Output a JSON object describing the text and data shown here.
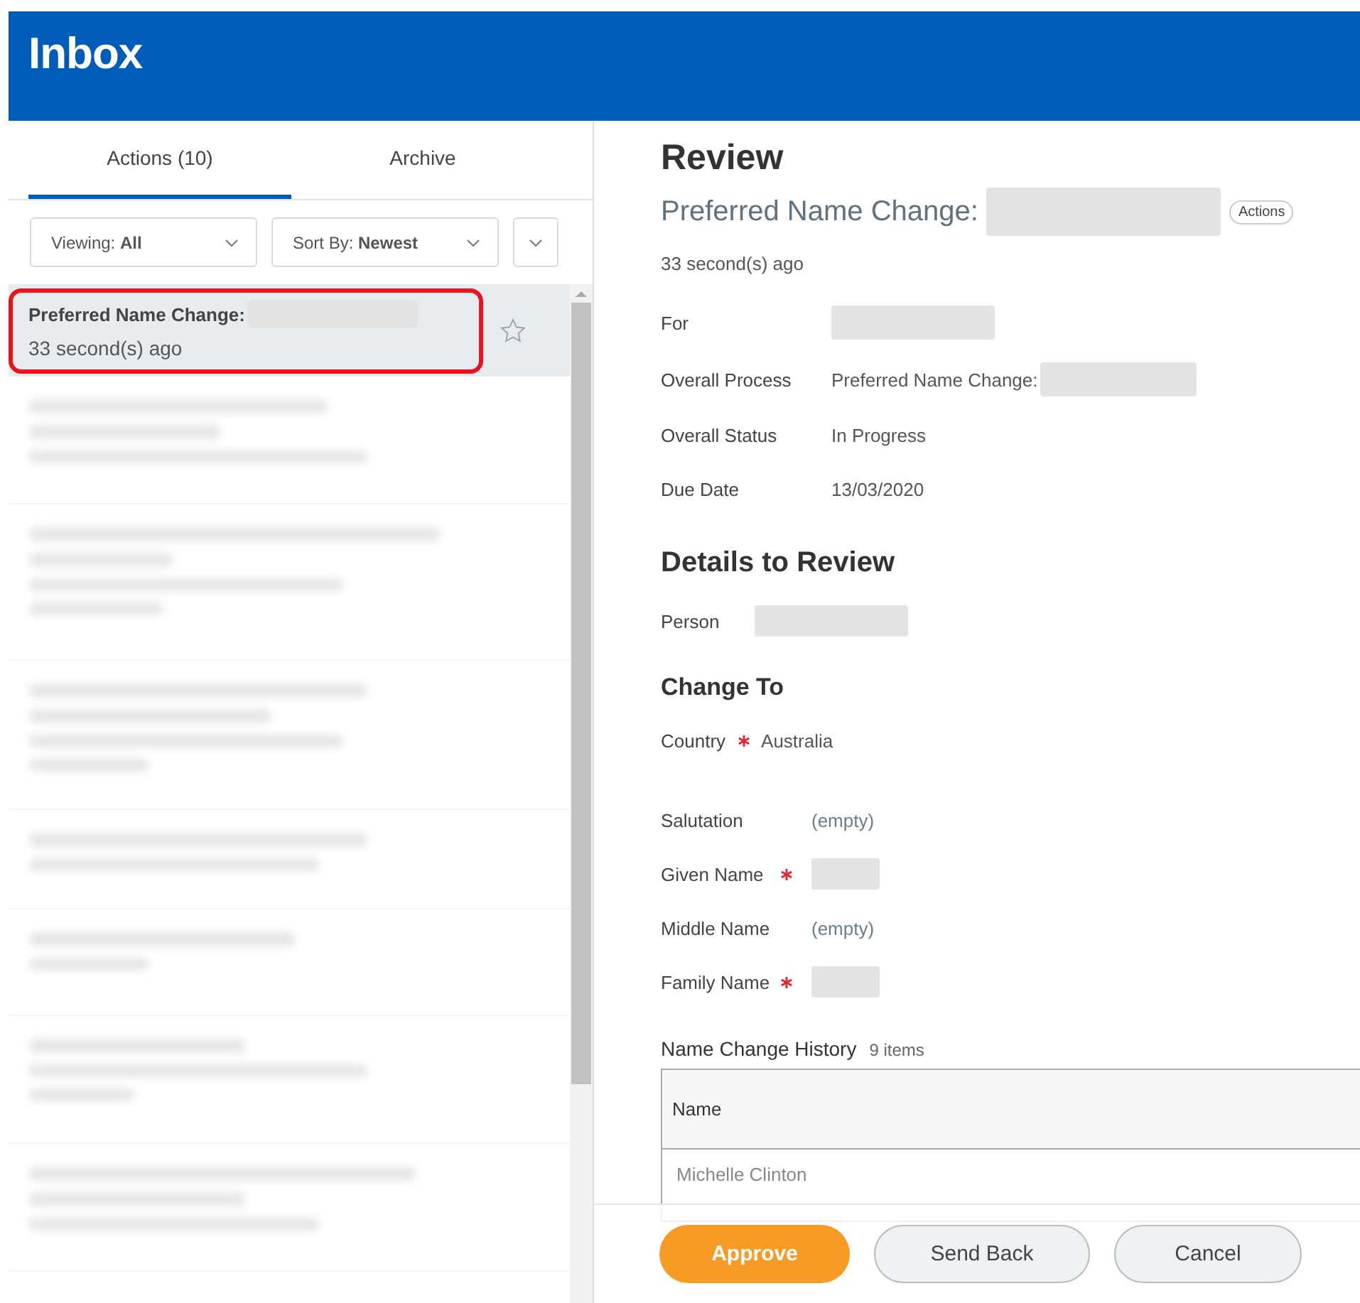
{
  "header": {
    "title": "Inbox"
  },
  "tabs": [
    {
      "label": "Actions (10)",
      "selected": true
    },
    {
      "label": "Archive",
      "selected": false
    }
  ],
  "filters": [
    "Viewing: **All**",
    "Sort By: **Newest**"
  ],
  "inbox_items": [
    {
      "kind": "task",
      "title": "Preferred Name Change:",
      "time": "33 second(s) ago",
      "selected": true,
      "highlighted": true
    },
    {
      "kind": "redacted",
      "selected": false
    },
    {
      "kind": "redacted",
      "selected": false
    },
    {
      "kind": "redacted",
      "selected": false
    },
    {
      "kind": "redacted",
      "selected": false
    },
    {
      "kind": "redacted",
      "selected": false
    },
    {
      "kind": "redacted",
      "selected": false
    },
    {
      "kind": "redacted",
      "selected": false
    }
  ],
  "review": {
    "heading": "Review",
    "subtitle": "Preferred Name Change:",
    "actions_button": "Actions",
    "time": "33 second(s) ago",
    "fields": [
      {
        "label": "For",
        "kind": "redacted"
      },
      {
        "label": "Overall Process",
        "kind": "text",
        "value": "Preferred Name Change:",
        "redacted_suffix": true
      },
      {
        "label": "Overall Status",
        "kind": "text",
        "value": "In Progress"
      },
      {
        "label": "Due Date",
        "kind": "text",
        "value": "13/03/2020"
      }
    ]
  },
  "details": {
    "heading": "Details to Review",
    "fields": [
      {
        "label": "Person",
        "kind": "redacted"
      }
    ]
  },
  "change_to": {
    "heading": "Change To",
    "country": {
      "label": "Country",
      "required": true,
      "value": "Australia"
    },
    "fields": [
      {
        "label": "Salutation",
        "required": false,
        "kind": "empty",
        "value": "(empty)"
      },
      {
        "label": "Given Name",
        "required": true,
        "kind": "redacted"
      },
      {
        "label": "Middle Name",
        "required": false,
        "kind": "empty",
        "value": "(empty)"
      },
      {
        "label": "Family Name",
        "required": true,
        "kind": "redacted"
      }
    ]
  },
  "history": {
    "title": "Name Change History",
    "count": "9 items",
    "column": "Name",
    "rows": [
      "Michelle Clinton"
    ]
  },
  "buttons": [
    {
      "label": "Approve",
      "kind": "primary"
    },
    {
      "label": "Send Back",
      "kind": "secondary"
    },
    {
      "label": "Cancel",
      "kind": "secondary"
    }
  ]
}
